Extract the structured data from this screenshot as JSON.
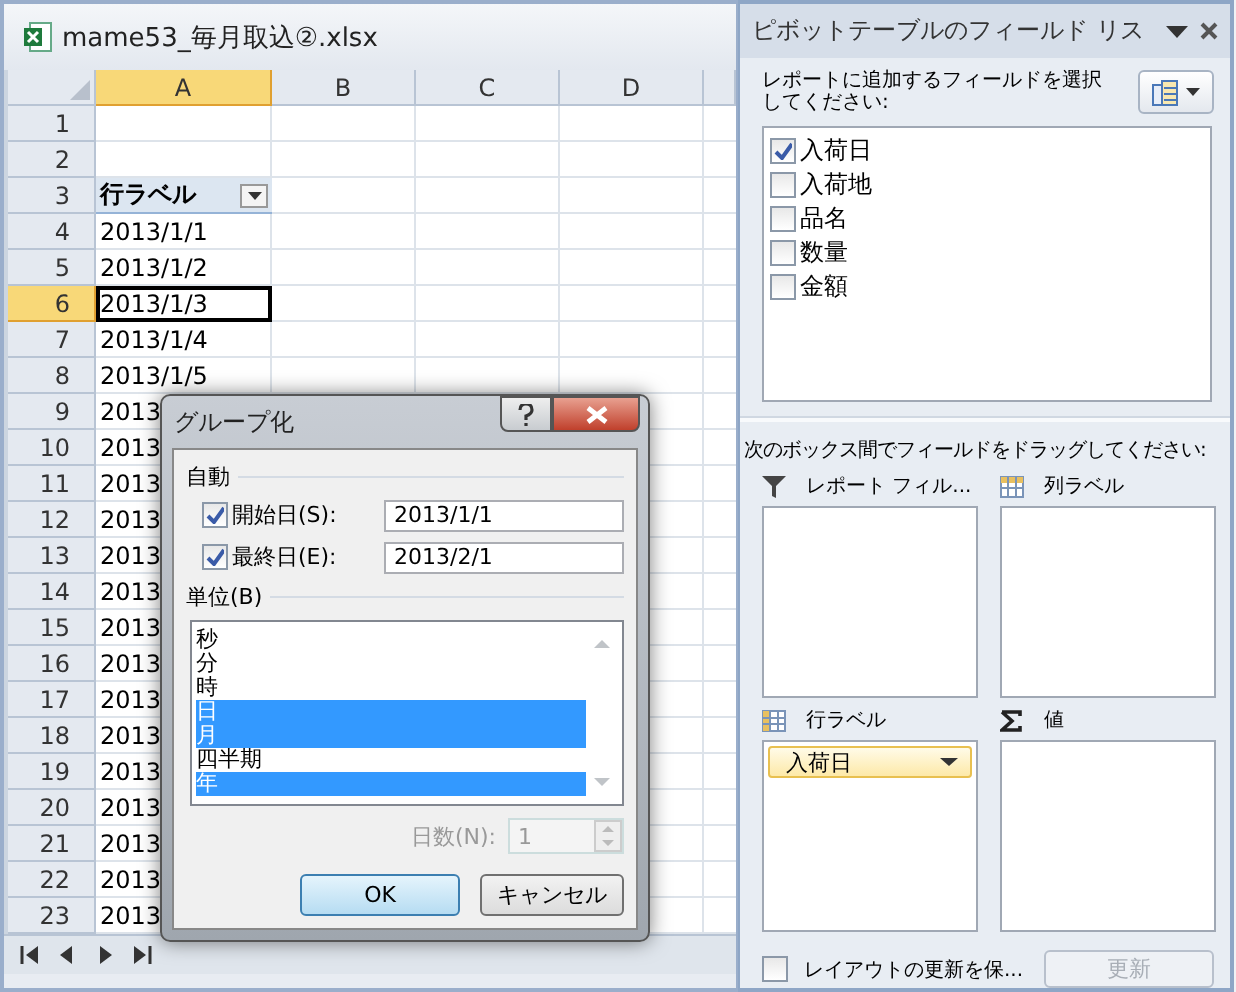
{
  "window": {
    "title": "mame53_毎月取込②.xlsx"
  },
  "sheet": {
    "columns": [
      {
        "label": "A",
        "selected": true
      },
      {
        "label": "B",
        "selected": false
      },
      {
        "label": "C",
        "selected": false
      },
      {
        "label": "D",
        "selected": false
      }
    ],
    "rows": [
      {
        "number": "1",
        "selected": false
      },
      {
        "number": "2",
        "selected": false
      },
      {
        "number": "3",
        "selected": false,
        "kind": "header",
        "cell": "行ラベル"
      },
      {
        "number": "4",
        "selected": false,
        "cell": "2013/1/1"
      },
      {
        "number": "5",
        "selected": false,
        "cell": "2013/1/2"
      },
      {
        "number": "6",
        "selected": true,
        "cell": "2013/1/3"
      },
      {
        "number": "7",
        "selected": false,
        "cell": "2013/1/4"
      },
      {
        "number": "8",
        "selected": false,
        "cell": "2013/1/5"
      },
      {
        "number": "9",
        "selected": false,
        "cell": "2013"
      },
      {
        "number": "10",
        "selected": false,
        "cell": "2013"
      },
      {
        "number": "11",
        "selected": false,
        "cell": "2013"
      },
      {
        "number": "12",
        "selected": false,
        "cell": "2013"
      },
      {
        "number": "13",
        "selected": false,
        "cell": "2013"
      },
      {
        "number": "14",
        "selected": false,
        "cell": "2013"
      },
      {
        "number": "15",
        "selected": false,
        "cell": "2013"
      },
      {
        "number": "16",
        "selected": false,
        "cell": "2013"
      },
      {
        "number": "17",
        "selected": false,
        "cell": "2013"
      },
      {
        "number": "18",
        "selected": false,
        "cell": "2013"
      },
      {
        "number": "19",
        "selected": false,
        "cell": "2013"
      },
      {
        "number": "20",
        "selected": false,
        "cell": "2013"
      },
      {
        "number": "21",
        "selected": false,
        "cell": "2013"
      },
      {
        "number": "22",
        "selected": false,
        "cell": "2013"
      },
      {
        "number": "23",
        "selected": false,
        "cell": "2013"
      }
    ]
  },
  "field_list": {
    "title": "ピボットテーブルのフィールド リス",
    "instruction": "レポートに追加するフィールドを選択してください:",
    "fields": [
      {
        "label": "入荷日",
        "checked": true
      },
      {
        "label": "入荷地",
        "checked": false
      },
      {
        "label": "品名",
        "checked": false
      },
      {
        "label": "数量",
        "checked": false
      },
      {
        "label": "金額",
        "checked": false
      }
    ],
    "drag_instruction": "次のボックス間でフィールドをドラッグしてください:",
    "areas": [
      {
        "kind": "filter",
        "label": "レポート フィル..."
      },
      {
        "kind": "columns",
        "label": "列ラベル"
      },
      {
        "kind": "rows",
        "label": "行ラベル",
        "items": [
          "入荷日"
        ]
      },
      {
        "kind": "values",
        "label": "値"
      }
    ],
    "defer_update": {
      "label": "レイアウトの更新を保...",
      "checked": false
    },
    "update_button": {
      "label": "更新",
      "disabled": true
    }
  },
  "dialog": {
    "title": "グループ化",
    "auto_label": "自動",
    "start": {
      "label": "開始日(S):",
      "checked": true,
      "value": "2013/1/1"
    },
    "end": {
      "label": "最終日(E):",
      "checked": true,
      "value": "2013/2/1"
    },
    "unit_label": "単位(B)",
    "units": [
      {
        "label": "秒",
        "selected": false
      },
      {
        "label": "分",
        "selected": false
      },
      {
        "label": "時",
        "selected": false
      },
      {
        "label": "日",
        "selected": true
      },
      {
        "label": "月",
        "selected": true
      },
      {
        "label": "四半期",
        "selected": false
      },
      {
        "label": "年",
        "selected": true
      }
    ],
    "days": {
      "label": "日数(N):",
      "value": "1",
      "disabled": true
    },
    "buttons": [
      {
        "label": "OK",
        "kind": "default"
      },
      {
        "label": "キャンセル",
        "kind": "normal"
      }
    ]
  }
}
